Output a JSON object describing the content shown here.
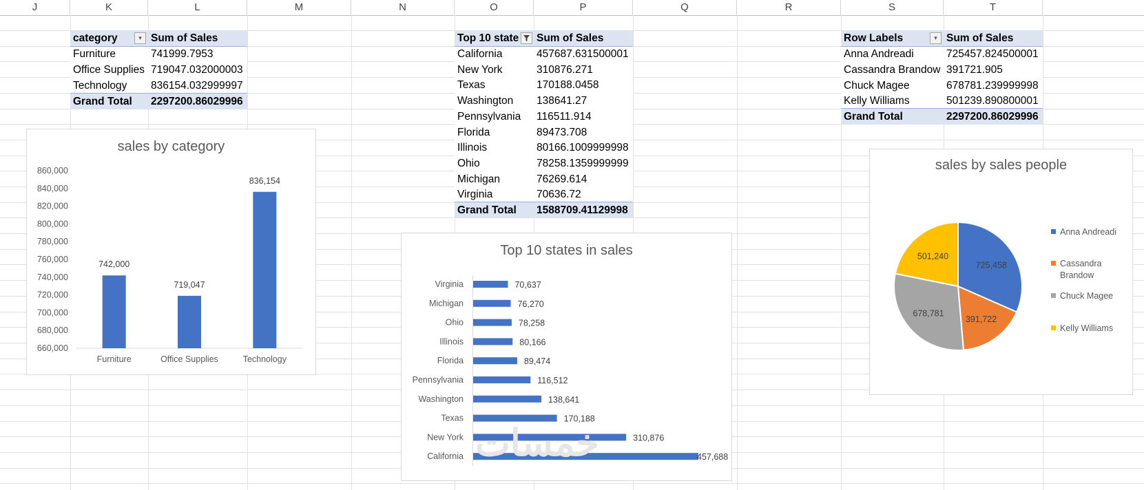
{
  "columns": [
    "J",
    "K",
    "L",
    "M",
    "N",
    "O",
    "P",
    "Q",
    "R",
    "S",
    "T"
  ],
  "category_pivot": {
    "header_label": "category",
    "header_value": "Sum of Sales",
    "rows": [
      {
        "label": "Furniture",
        "value": "741999.7953"
      },
      {
        "label": "Office Supplies",
        "value": "719047.032000003"
      },
      {
        "label": "Technology",
        "value": "836154.032999997"
      }
    ],
    "total_label": "Grand Total",
    "total_value": "2297200.86029996"
  },
  "state_pivot": {
    "header_label": "Top 10 state",
    "header_value": "Sum of Sales",
    "rows": [
      {
        "label": "California",
        "value": "457687.631500001"
      },
      {
        "label": "New York",
        "value": "310876.271"
      },
      {
        "label": "Texas",
        "value": "170188.0458"
      },
      {
        "label": "Washington",
        "value": "138641.27"
      },
      {
        "label": "Pennsylvania",
        "value": "116511.914"
      },
      {
        "label": "Florida",
        "value": "89473.708"
      },
      {
        "label": "Illinois",
        "value": "80166.1009999998"
      },
      {
        "label": "Ohio",
        "value": "78258.1359999999"
      },
      {
        "label": "Michigan",
        "value": "76269.614"
      },
      {
        "label": "Virginia",
        "value": "70636.72"
      }
    ],
    "total_label": "Grand Total",
    "total_value": "1588709.41129998"
  },
  "people_pivot": {
    "header_label": "Row Labels",
    "header_value": "Sum of Sales",
    "rows": [
      {
        "label": "Anna Andreadi",
        "value": "725457.824500001"
      },
      {
        "label": "Cassandra Brandow",
        "value": "391721.905"
      },
      {
        "label": "Chuck Magee",
        "value": "678781.239999998"
      },
      {
        "label": "Kelly Williams",
        "value": "501239.890800001"
      }
    ],
    "total_label": "Grand Total",
    "total_value": "2297200.86029996"
  },
  "chart_data": [
    {
      "type": "bar",
      "orientation": "vertical",
      "title": "sales by category",
      "categories": [
        "Furniture",
        "Office Supplies",
        "Technology"
      ],
      "values": [
        742000,
        719047,
        836154
      ],
      "data_labels": [
        "742,000",
        "719,047",
        "836,154"
      ],
      "ylim": [
        660000,
        860000
      ],
      "yticks": [
        "860,000",
        "840,000",
        "820,000",
        "800,000",
        "780,000",
        "760,000",
        "740,000",
        "720,000",
        "700,000",
        "680,000",
        "660,000"
      ],
      "ytick_values": [
        860000,
        840000,
        820000,
        800000,
        780000,
        760000,
        740000,
        720000,
        700000,
        680000,
        660000
      ],
      "color": "#4472c4",
      "grid": false
    },
    {
      "type": "bar",
      "orientation": "horizontal",
      "title": "Top 10 states in sales",
      "categories": [
        "Virginia",
        "Michigan",
        "Ohio",
        "Illinois",
        "Florida",
        "Pennsylvania",
        "Washington",
        "Texas",
        "New York",
        "California"
      ],
      "values": [
        70637,
        76270,
        78258,
        80166,
        89474,
        116512,
        138641,
        170188,
        310876,
        457688
      ],
      "data_labels": [
        "70,637",
        "76,270",
        "78,258",
        "80,166",
        "89,474",
        "116,512",
        "138,641",
        "170,188",
        "310,876",
        "457,688"
      ],
      "xlim": [
        0,
        457688
      ],
      "color": "#4472c4",
      "grid": false
    },
    {
      "type": "pie",
      "title": "sales by sales people",
      "labels": [
        "Anna Andreadi",
        "Cassandra Brandow",
        "Chuck Magee",
        "Kelly Williams"
      ],
      "legend_lines": [
        [
          "Anna Andreadi"
        ],
        [
          "Cassandra",
          "Brandow"
        ],
        [
          "Chuck Magee"
        ],
        [
          "Kelly Williams"
        ]
      ],
      "values": [
        725458,
        391722,
        678781,
        501240
      ],
      "data_labels": [
        "725,458",
        "391,722",
        "678,781",
        "501,240"
      ],
      "colors": [
        "#4472c4",
        "#ed7d31",
        "#a5a5a5",
        "#ffc000"
      ],
      "legend": "right"
    }
  ]
}
